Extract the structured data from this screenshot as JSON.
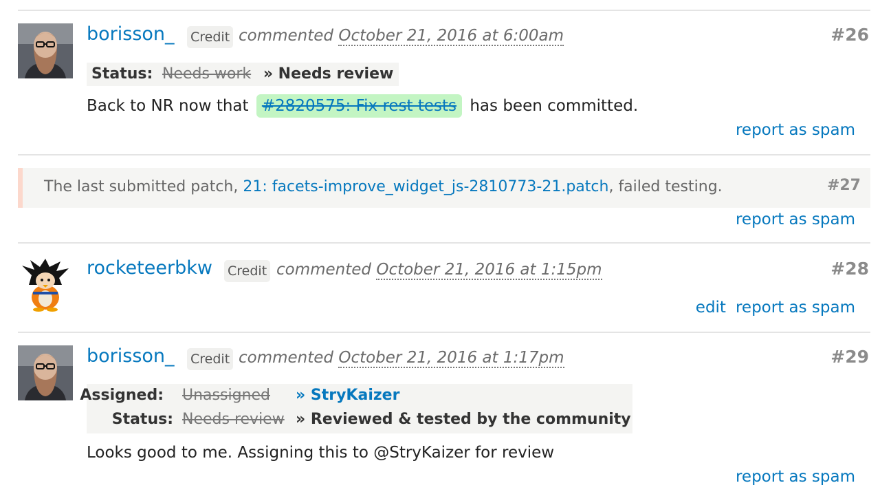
{
  "comments": [
    {
      "user": "borisson_",
      "credit": "Credit",
      "commented": "commented",
      "date": "October 21, 2016 at 6:00am",
      "number": "#26",
      "status_label": "Status:",
      "status_old": "Needs work",
      "status_new": "» Needs review",
      "body_prefix": "Back to NR now that",
      "issue_link": "#2820575: Fix rest tests",
      "body_suffix": "has been committed.",
      "spam": "report as spam"
    },
    {
      "user": "rocketeerbkw",
      "credit": "Credit",
      "commented": "commented",
      "date": "October 21, 2016 at 1:15pm",
      "number": "#28",
      "edit": "edit",
      "spam": "report as spam"
    },
    {
      "user": "borisson_",
      "credit": "Credit",
      "commented": "commented",
      "date": "October 21, 2016 at 1:17pm",
      "number": "#29",
      "assigned_label": "Assigned:",
      "assigned_old": "Unassigned",
      "assigned_new": "» StryKaizer",
      "status_label": "Status:",
      "status_old": "Needs review",
      "status_new": "» Reviewed & tested by the community",
      "body": "Looks good to me. Assigning this to @StryKaizer for review",
      "spam": "report as spam"
    }
  ],
  "system": {
    "prefix": "The last submitted patch,",
    "link": "21: facets-improve_widget_js-2810773-21.patch",
    "suffix": ", failed testing.",
    "number": "#27",
    "spam": "report as spam"
  }
}
